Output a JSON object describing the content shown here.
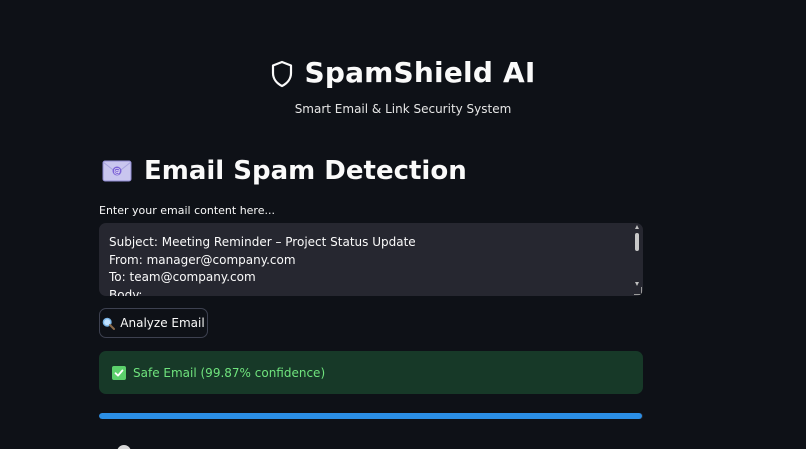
{
  "header": {
    "title": "SpamShield AI",
    "subtitle": "Smart Email & Link Security System",
    "icon": "shield-icon"
  },
  "section": {
    "title": "Email Spam Detection",
    "icon": "envelope-icon"
  },
  "email_input": {
    "label": "Enter your email content here...",
    "lines": [
      "Subject: Meeting Reminder – Project Status Update",
      "From: manager@company.com",
      "To: team@company.com",
      "Body:"
    ]
  },
  "analyze_button": {
    "label": "Analyze Email",
    "icon": "magnifier-icon"
  },
  "result": {
    "text": "Safe Email (99.87% confidence)",
    "icon": "check-icon",
    "color": "#6fe37d"
  },
  "progress": {
    "value": 0.9987,
    "color": "#2b8fe6"
  },
  "colors": {
    "background": "#0e1117",
    "input_background": "#262730",
    "success_background": "#173928"
  }
}
